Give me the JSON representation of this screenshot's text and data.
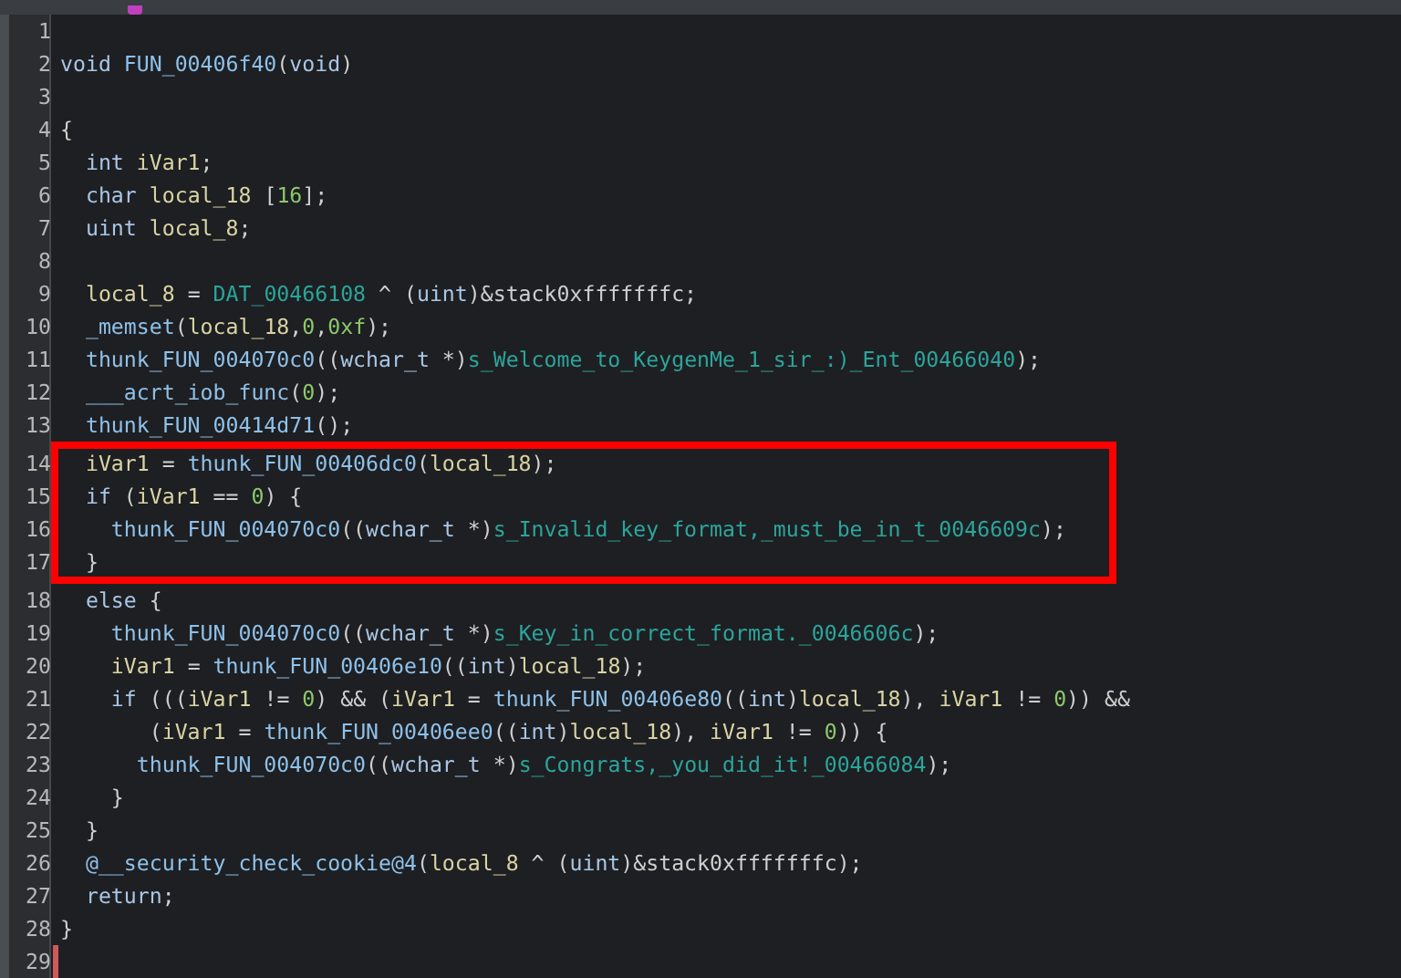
{
  "lines": [
    {
      "number": "1",
      "boxed": false,
      "caret": false
    },
    {
      "number": "2",
      "boxed": false,
      "caret": false,
      "tokens": [
        {
          "kind": "kw",
          "text": "void "
        },
        {
          "kind": "fn",
          "text": "FUN_00406f40"
        },
        {
          "kind": "op",
          "text": "("
        },
        {
          "kind": "kw",
          "text": "void"
        },
        {
          "kind": "op",
          "text": ")"
        }
      ]
    },
    {
      "number": "3",
      "boxed": false,
      "caret": false
    },
    {
      "number": "4",
      "boxed": false,
      "caret": false,
      "tokens": [
        {
          "kind": "op",
          "text": "{"
        }
      ]
    },
    {
      "number": "5",
      "boxed": false,
      "caret": false,
      "tokens": [
        {
          "kind": "kw",
          "text": "  int "
        },
        {
          "kind": "var",
          "text": "iVar1"
        },
        {
          "kind": "op",
          "text": ";"
        }
      ]
    },
    {
      "number": "6",
      "boxed": false,
      "caret": false,
      "tokens": [
        {
          "kind": "kw",
          "text": "  char "
        },
        {
          "kind": "var",
          "text": "local_18 "
        },
        {
          "kind": "op",
          "text": "["
        },
        {
          "kind": "num",
          "text": "16"
        },
        {
          "kind": "op",
          "text": "];"
        }
      ]
    },
    {
      "number": "7",
      "boxed": false,
      "caret": false,
      "tokens": [
        {
          "kind": "kw",
          "text": "  uint "
        },
        {
          "kind": "var",
          "text": "local_8"
        },
        {
          "kind": "op",
          "text": ";"
        }
      ]
    },
    {
      "number": "8",
      "boxed": false,
      "caret": false
    },
    {
      "number": "9",
      "boxed": false,
      "caret": false,
      "tokens": [
        {
          "kind": "var",
          "text": "  local_8 "
        },
        {
          "kind": "op",
          "text": "= "
        },
        {
          "kind": "str",
          "text": "DAT_00466108"
        },
        {
          "kind": "op",
          "text": " ^ ("
        },
        {
          "kind": "kw",
          "text": "uint"
        },
        {
          "kind": "op",
          "text": ")&stack0xfffffffc;"
        }
      ]
    },
    {
      "number": "10",
      "boxed": false,
      "caret": false,
      "tokens": [
        {
          "kind": "fn",
          "text": "  _memset"
        },
        {
          "kind": "op",
          "text": "("
        },
        {
          "kind": "var",
          "text": "local_18"
        },
        {
          "kind": "op",
          "text": ","
        },
        {
          "kind": "num",
          "text": "0"
        },
        {
          "kind": "op",
          "text": ","
        },
        {
          "kind": "num",
          "text": "0xf"
        },
        {
          "kind": "op",
          "text": ");"
        }
      ]
    },
    {
      "number": "11",
      "boxed": false,
      "caret": false,
      "tokens": [
        {
          "kind": "fn",
          "text": "  thunk_FUN_004070c0"
        },
        {
          "kind": "op",
          "text": "(("
        },
        {
          "kind": "kw",
          "text": "wchar_t"
        },
        {
          "kind": "op",
          "text": " *)"
        },
        {
          "kind": "str",
          "text": "s_Welcome_to_KeygenMe_1_sir_:)_Ent_00466040"
        },
        {
          "kind": "op",
          "text": ");"
        }
      ]
    },
    {
      "number": "12",
      "boxed": false,
      "caret": false,
      "tokens": [
        {
          "kind": "fn",
          "text": "  ___acrt_iob_func"
        },
        {
          "kind": "op",
          "text": "("
        },
        {
          "kind": "num",
          "text": "0"
        },
        {
          "kind": "op",
          "text": ");"
        }
      ]
    },
    {
      "number": "13",
      "boxed": false,
      "caret": false,
      "tokens": [
        {
          "kind": "fn",
          "text": "  thunk_FUN_00414d71"
        },
        {
          "kind": "op",
          "text": "();"
        }
      ]
    },
    {
      "number": "14",
      "boxed": true,
      "caret": false,
      "tokens": [
        {
          "kind": "var",
          "text": "  iVar1 "
        },
        {
          "kind": "op",
          "text": "= "
        },
        {
          "kind": "fn",
          "text": "thunk_FUN_00406dc0"
        },
        {
          "kind": "op",
          "text": "("
        },
        {
          "kind": "var",
          "text": "local_18"
        },
        {
          "kind": "op",
          "text": ");"
        }
      ]
    },
    {
      "number": "15",
      "boxed": true,
      "caret": false,
      "tokens": [
        {
          "kind": "kw",
          "text": "  if "
        },
        {
          "kind": "op",
          "text": "("
        },
        {
          "kind": "var",
          "text": "iVar1"
        },
        {
          "kind": "op",
          "text": " == "
        },
        {
          "kind": "num",
          "text": "0"
        },
        {
          "kind": "op",
          "text": ") {"
        }
      ]
    },
    {
      "number": "16",
      "boxed": true,
      "caret": false,
      "tokens": [
        {
          "kind": "fn",
          "text": "    thunk_FUN_004070c0"
        },
        {
          "kind": "op",
          "text": "(("
        },
        {
          "kind": "kw",
          "text": "wchar_t"
        },
        {
          "kind": "op",
          "text": " *)"
        },
        {
          "kind": "str",
          "text": "s_Invalid_key_format,_must_be_in_t_0046609c"
        },
        {
          "kind": "op",
          "text": ");"
        }
      ]
    },
    {
      "number": "17",
      "boxed": true,
      "caret": false,
      "tokens": [
        {
          "kind": "op",
          "text": "  }"
        }
      ]
    },
    {
      "number": "18",
      "boxed": false,
      "caret": false,
      "tokens": [
        {
          "kind": "kw",
          "text": "  else "
        },
        {
          "kind": "op",
          "text": "{"
        }
      ]
    },
    {
      "number": "19",
      "boxed": false,
      "caret": false,
      "tokens": [
        {
          "kind": "fn",
          "text": "    thunk_FUN_004070c0"
        },
        {
          "kind": "op",
          "text": "(("
        },
        {
          "kind": "kw",
          "text": "wchar_t"
        },
        {
          "kind": "op",
          "text": " *)"
        },
        {
          "kind": "str",
          "text": "s_Key_in_correct_format._0046606c"
        },
        {
          "kind": "op",
          "text": ");"
        }
      ]
    },
    {
      "number": "20",
      "boxed": false,
      "caret": false,
      "tokens": [
        {
          "kind": "var",
          "text": "    iVar1 "
        },
        {
          "kind": "op",
          "text": "= "
        },
        {
          "kind": "fn",
          "text": "thunk_FUN_00406e10"
        },
        {
          "kind": "op",
          "text": "(("
        },
        {
          "kind": "kw",
          "text": "int"
        },
        {
          "kind": "op",
          "text": ")"
        },
        {
          "kind": "var",
          "text": "local_18"
        },
        {
          "kind": "op",
          "text": ");"
        }
      ]
    },
    {
      "number": "21",
      "boxed": false,
      "caret": false,
      "tokens": [
        {
          "kind": "kw",
          "text": "    if "
        },
        {
          "kind": "op",
          "text": "((("
        },
        {
          "kind": "var",
          "text": "iVar1"
        },
        {
          "kind": "op",
          "text": " != "
        },
        {
          "kind": "num",
          "text": "0"
        },
        {
          "kind": "op",
          "text": ") && ("
        },
        {
          "kind": "var",
          "text": "iVar1"
        },
        {
          "kind": "op",
          "text": " = "
        },
        {
          "kind": "fn",
          "text": "thunk_FUN_00406e80"
        },
        {
          "kind": "op",
          "text": "(("
        },
        {
          "kind": "kw",
          "text": "int"
        },
        {
          "kind": "op",
          "text": ")"
        },
        {
          "kind": "var",
          "text": "local_18"
        },
        {
          "kind": "op",
          "text": "), "
        },
        {
          "kind": "var",
          "text": "iVar1"
        },
        {
          "kind": "op",
          "text": " != "
        },
        {
          "kind": "num",
          "text": "0"
        },
        {
          "kind": "op",
          "text": ")) &&"
        }
      ]
    },
    {
      "number": "22",
      "boxed": false,
      "caret": false,
      "tokens": [
        {
          "kind": "op",
          "text": "       ("
        },
        {
          "kind": "var",
          "text": "iVar1"
        },
        {
          "kind": "op",
          "text": " = "
        },
        {
          "kind": "fn",
          "text": "thunk_FUN_00406ee0"
        },
        {
          "kind": "op",
          "text": "(("
        },
        {
          "kind": "kw",
          "text": "int"
        },
        {
          "kind": "op",
          "text": ")"
        },
        {
          "kind": "var",
          "text": "local_18"
        },
        {
          "kind": "op",
          "text": "), "
        },
        {
          "kind": "var",
          "text": "iVar1"
        },
        {
          "kind": "op",
          "text": " != "
        },
        {
          "kind": "num",
          "text": "0"
        },
        {
          "kind": "op",
          "text": ")) {"
        }
      ]
    },
    {
      "number": "23",
      "boxed": false,
      "caret": false,
      "tokens": [
        {
          "kind": "fn",
          "text": "      thunk_FUN_004070c0"
        },
        {
          "kind": "op",
          "text": "(("
        },
        {
          "kind": "kw",
          "text": "wchar_t"
        },
        {
          "kind": "op",
          "text": " *)"
        },
        {
          "kind": "str",
          "text": "s_Congrats,_you_did_it!_00466084"
        },
        {
          "kind": "op",
          "text": ");"
        }
      ]
    },
    {
      "number": "24",
      "boxed": false,
      "caret": false,
      "tokens": [
        {
          "kind": "op",
          "text": "    }"
        }
      ]
    },
    {
      "number": "25",
      "boxed": false,
      "caret": false,
      "tokens": [
        {
          "kind": "op",
          "text": "  }"
        }
      ]
    },
    {
      "number": "26",
      "boxed": false,
      "caret": false,
      "tokens": [
        {
          "kind": "fn",
          "text": "  @__security_check_cookie@4"
        },
        {
          "kind": "op",
          "text": "("
        },
        {
          "kind": "var",
          "text": "local_8"
        },
        {
          "kind": "op",
          "text": " ^ ("
        },
        {
          "kind": "kw",
          "text": "uint"
        },
        {
          "kind": "op",
          "text": ")&stack0xfffffffc);"
        }
      ]
    },
    {
      "number": "27",
      "boxed": false,
      "caret": false,
      "tokens": [
        {
          "kind": "kw",
          "text": "  return"
        },
        {
          "kind": "op",
          "text": ";"
        }
      ]
    },
    {
      "number": "28",
      "boxed": false,
      "caret": false,
      "tokens": [
        {
          "kind": "op",
          "text": "}"
        }
      ]
    },
    {
      "number": "29",
      "boxed": false,
      "caret": true
    }
  ]
}
